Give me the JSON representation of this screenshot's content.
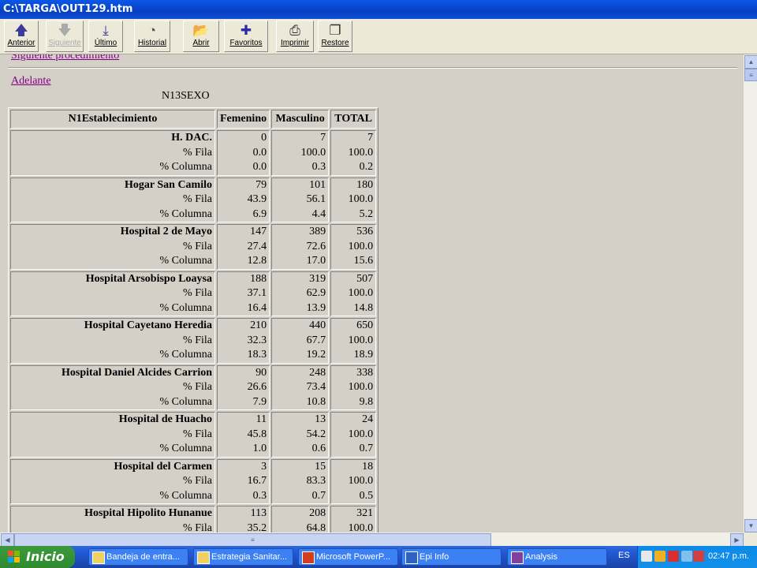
{
  "window": {
    "title": "C:\\TARGA\\OUT129.htm"
  },
  "toolbar": [
    {
      "label": "Anterior",
      "icon": "up-arrow-icon",
      "enabled": true
    },
    {
      "label": "Siguiente",
      "icon": "down-arrow-icon",
      "enabled": false
    },
    {
      "label": "Último",
      "icon": "last-icon",
      "enabled": true
    },
    {
      "label": "Historial",
      "icon": "history-icon",
      "enabled": true
    },
    {
      "label": "Abrir",
      "icon": "open-folder-icon",
      "enabled": true
    },
    {
      "label": "Favoritos",
      "icon": "favorites-icon",
      "enabled": true
    },
    {
      "label": "Imprimir",
      "icon": "printer-icon",
      "enabled": true
    },
    {
      "label": "Restore",
      "icon": "restore-icon",
      "enabled": true
    }
  ],
  "links": {
    "previous": "Siguiente procedimiento",
    "next": "Adelante"
  },
  "table": {
    "variable_title": "N13SEXO",
    "headers": [
      "N1Establecimiento",
      "Femenino",
      "Masculino",
      "TOTAL"
    ],
    "row_labels": [
      "% Fila",
      "% Columna"
    ],
    "groups": [
      {
        "name": "H. DAC.",
        "rows": [
          [
            "0",
            "7",
            "7"
          ],
          [
            "0.0",
            "100.0",
            "100.0"
          ],
          [
            "0.0",
            "0.3",
            "0.2"
          ]
        ]
      },
      {
        "name": "Hogar San Camilo",
        "rows": [
          [
            "79",
            "101",
            "180"
          ],
          [
            "43.9",
            "56.1",
            "100.0"
          ],
          [
            "6.9",
            "4.4",
            "5.2"
          ]
        ]
      },
      {
        "name": "Hospital 2 de Mayo",
        "rows": [
          [
            "147",
            "389",
            "536"
          ],
          [
            "27.4",
            "72.6",
            "100.0"
          ],
          [
            "12.8",
            "17.0",
            "15.6"
          ]
        ]
      },
      {
        "name": "Hospital Arsobispo Loaysa",
        "rows": [
          [
            "188",
            "319",
            "507"
          ],
          [
            "37.1",
            "62.9",
            "100.0"
          ],
          [
            "16.4",
            "13.9",
            "14.8"
          ]
        ]
      },
      {
        "name": "Hospital Cayetano Heredia",
        "rows": [
          [
            "210",
            "440",
            "650"
          ],
          [
            "32.3",
            "67.7",
            "100.0"
          ],
          [
            "18.3",
            "19.2",
            "18.9"
          ]
        ]
      },
      {
        "name": "Hospital Daniel Alcides Carrion",
        "rows": [
          [
            "90",
            "248",
            "338"
          ],
          [
            "26.6",
            "73.4",
            "100.0"
          ],
          [
            "7.9",
            "10.8",
            "9.8"
          ]
        ]
      },
      {
        "name": "Hospital de Huacho",
        "rows": [
          [
            "11",
            "13",
            "24"
          ],
          [
            "45.8",
            "54.2",
            "100.0"
          ],
          [
            "1.0",
            "0.6",
            "0.7"
          ]
        ]
      },
      {
        "name": "Hospital del Carmen",
        "rows": [
          [
            "3",
            "15",
            "18"
          ],
          [
            "16.7",
            "83.3",
            "100.0"
          ],
          [
            "0.3",
            "0.7",
            "0.5"
          ]
        ]
      },
      {
        "name": "Hospital Hipolito Hunanue",
        "rows": [
          [
            "113",
            "208",
            "321"
          ],
          [
            "35.2",
            "64.8",
            "100.0"
          ]
        ]
      }
    ]
  },
  "taskbar": {
    "start_label": "Inicio",
    "tasks": [
      "Bandeja de entra...",
      "Estrategia Sanitar...",
      "Microsoft PowerP...",
      "Epi Info",
      "Analysis"
    ],
    "language": "ES",
    "clock": "02:47 p.m."
  }
}
